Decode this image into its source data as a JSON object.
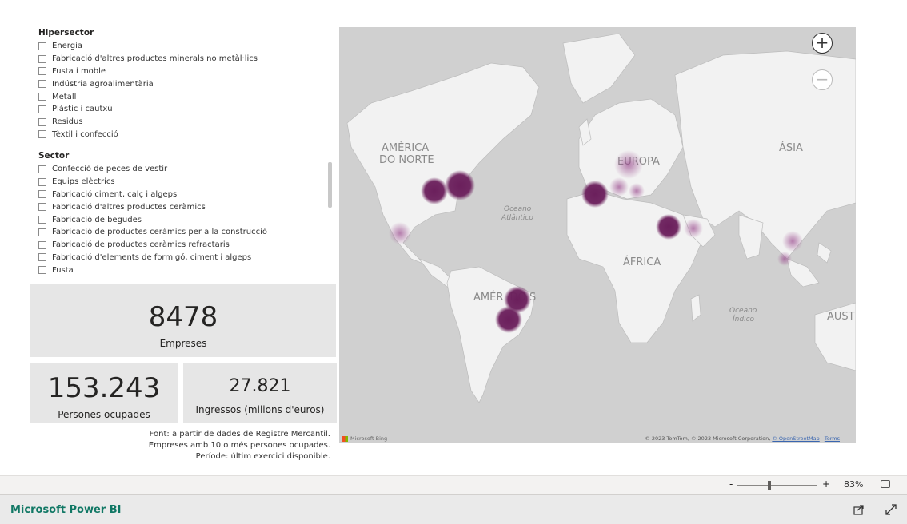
{
  "hipersector": {
    "title": "Hipersector",
    "items": [
      "Energia",
      "Fabricació d'altres productes minerals no metàl·lics",
      "Fusta i moble",
      "Indústria agroalimentària",
      "Metall",
      "Plàstic i cautxú",
      "Residus",
      "Tèxtil i confecció"
    ]
  },
  "sector": {
    "title": "Sector",
    "items": [
      "Confecció de peces de vestir",
      "Equips elèctrics",
      "Fabricació ciment, calç i algeps",
      "Fabricació d'altres productes ceràmics",
      "Fabricació de begudes",
      "Fabricació de productes ceràmics per a la construcció",
      "Fabricació de productes ceràmics refractaris",
      "Fabricació d'elements de formigó, ciment i algeps",
      "Fusta"
    ]
  },
  "kpi": {
    "empreses_value": "8478",
    "empreses_label": "Empreses",
    "persones_value": "153.243",
    "persones_label": "Persones ocupades",
    "ingressos_value": "27.821",
    "ingressos_label": "Ingressos (milions d'euros)"
  },
  "source": {
    "line1": "Font: a partir de dades de Registre Mercantil.",
    "line2": "Empreses amb 10 o més persones ocupades.",
    "line3": "Període: últim exercici disponible."
  },
  "map": {
    "labels": {
      "north_america": [
        "AMÈRICA",
        "DO NORTE"
      ],
      "europe": "EUROPA",
      "asia": "ÁSIA",
      "africa": "ÁFRICA",
      "south_america": "AMÉR  DO S",
      "atlantic": [
        "Oceano",
        "Atlântico"
      ],
      "indian": [
        "Oceano",
        "Índico"
      ],
      "australia": "AUST"
    },
    "zoom_in": "+",
    "zoom_out": "−",
    "bing": "Microsoft Bing",
    "copyright": "© 2023 TomTom, © 2023 Microsoft Corporation,",
    "osm": "© OpenStreetMap",
    "terms": "Terms",
    "bubble_color": "#6b1f5c"
  },
  "zoombar": {
    "minus": "-",
    "plus": "+",
    "zoom": "83%"
  },
  "footer": {
    "link": "Microsoft Power BI"
  }
}
